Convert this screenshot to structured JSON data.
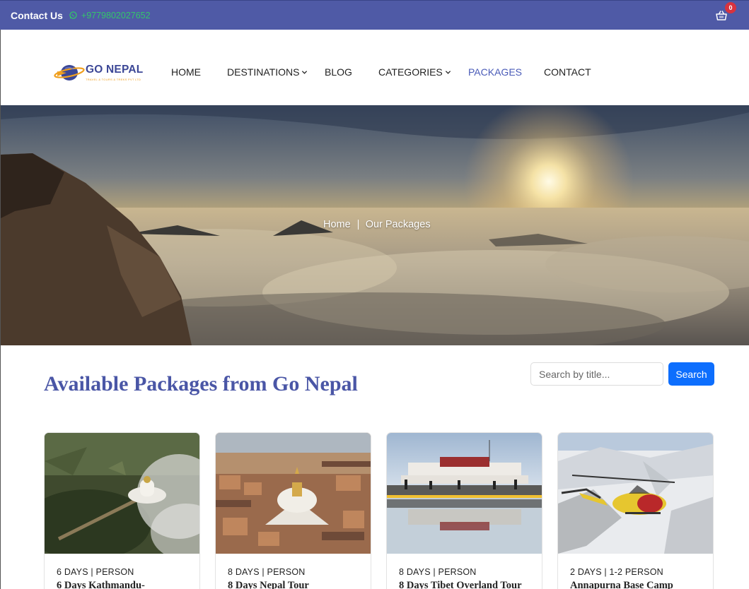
{
  "topbar": {
    "contact_label": "Contact Us",
    "phone": "+9779802027652",
    "cart_count": "0",
    "icons": {
      "whatsapp": "whatsapp-icon",
      "cart": "basket-icon"
    }
  },
  "header": {
    "logo_title": "GO NEPAL",
    "logo_subtitle": "TRAVEL & TOURS & TREKS PVT LTD",
    "nav": [
      {
        "label": "HOME"
      },
      {
        "label": "DESTINATIONS"
      },
      {
        "label": "BLOG"
      },
      {
        "label": "CATEGORIES"
      },
      {
        "label": "PACKAGES"
      },
      {
        "label": "CONTACT"
      }
    ]
  },
  "hero": {
    "breadcrumb_home": "Home",
    "breadcrumb_current": "Our Packages"
  },
  "main": {
    "title": "Available Packages from Go Nepal",
    "search_placeholder": "Search by title...",
    "search_button": "Search",
    "packages": [
      {
        "meta": "6 DAYS | PERSON",
        "title": "6 Days Kathmandu-"
      },
      {
        "meta": "8 DAYS | PERSON",
        "title": "8 Days Nepal Tour"
      },
      {
        "meta": "8 DAYS | PERSON",
        "title": "8 Days Tibet Overland Tour"
      },
      {
        "meta": "2 DAYS | 1-2 PERSON",
        "title": "Annapurna Base Camp"
      }
    ]
  },
  "colors": {
    "topbar": "#4f5aa6",
    "phone": "#34c56a",
    "brand": "#4a56a6",
    "nav_active": "#4a5bb8",
    "button": "#0d6efd",
    "badge": "#d8333e"
  }
}
